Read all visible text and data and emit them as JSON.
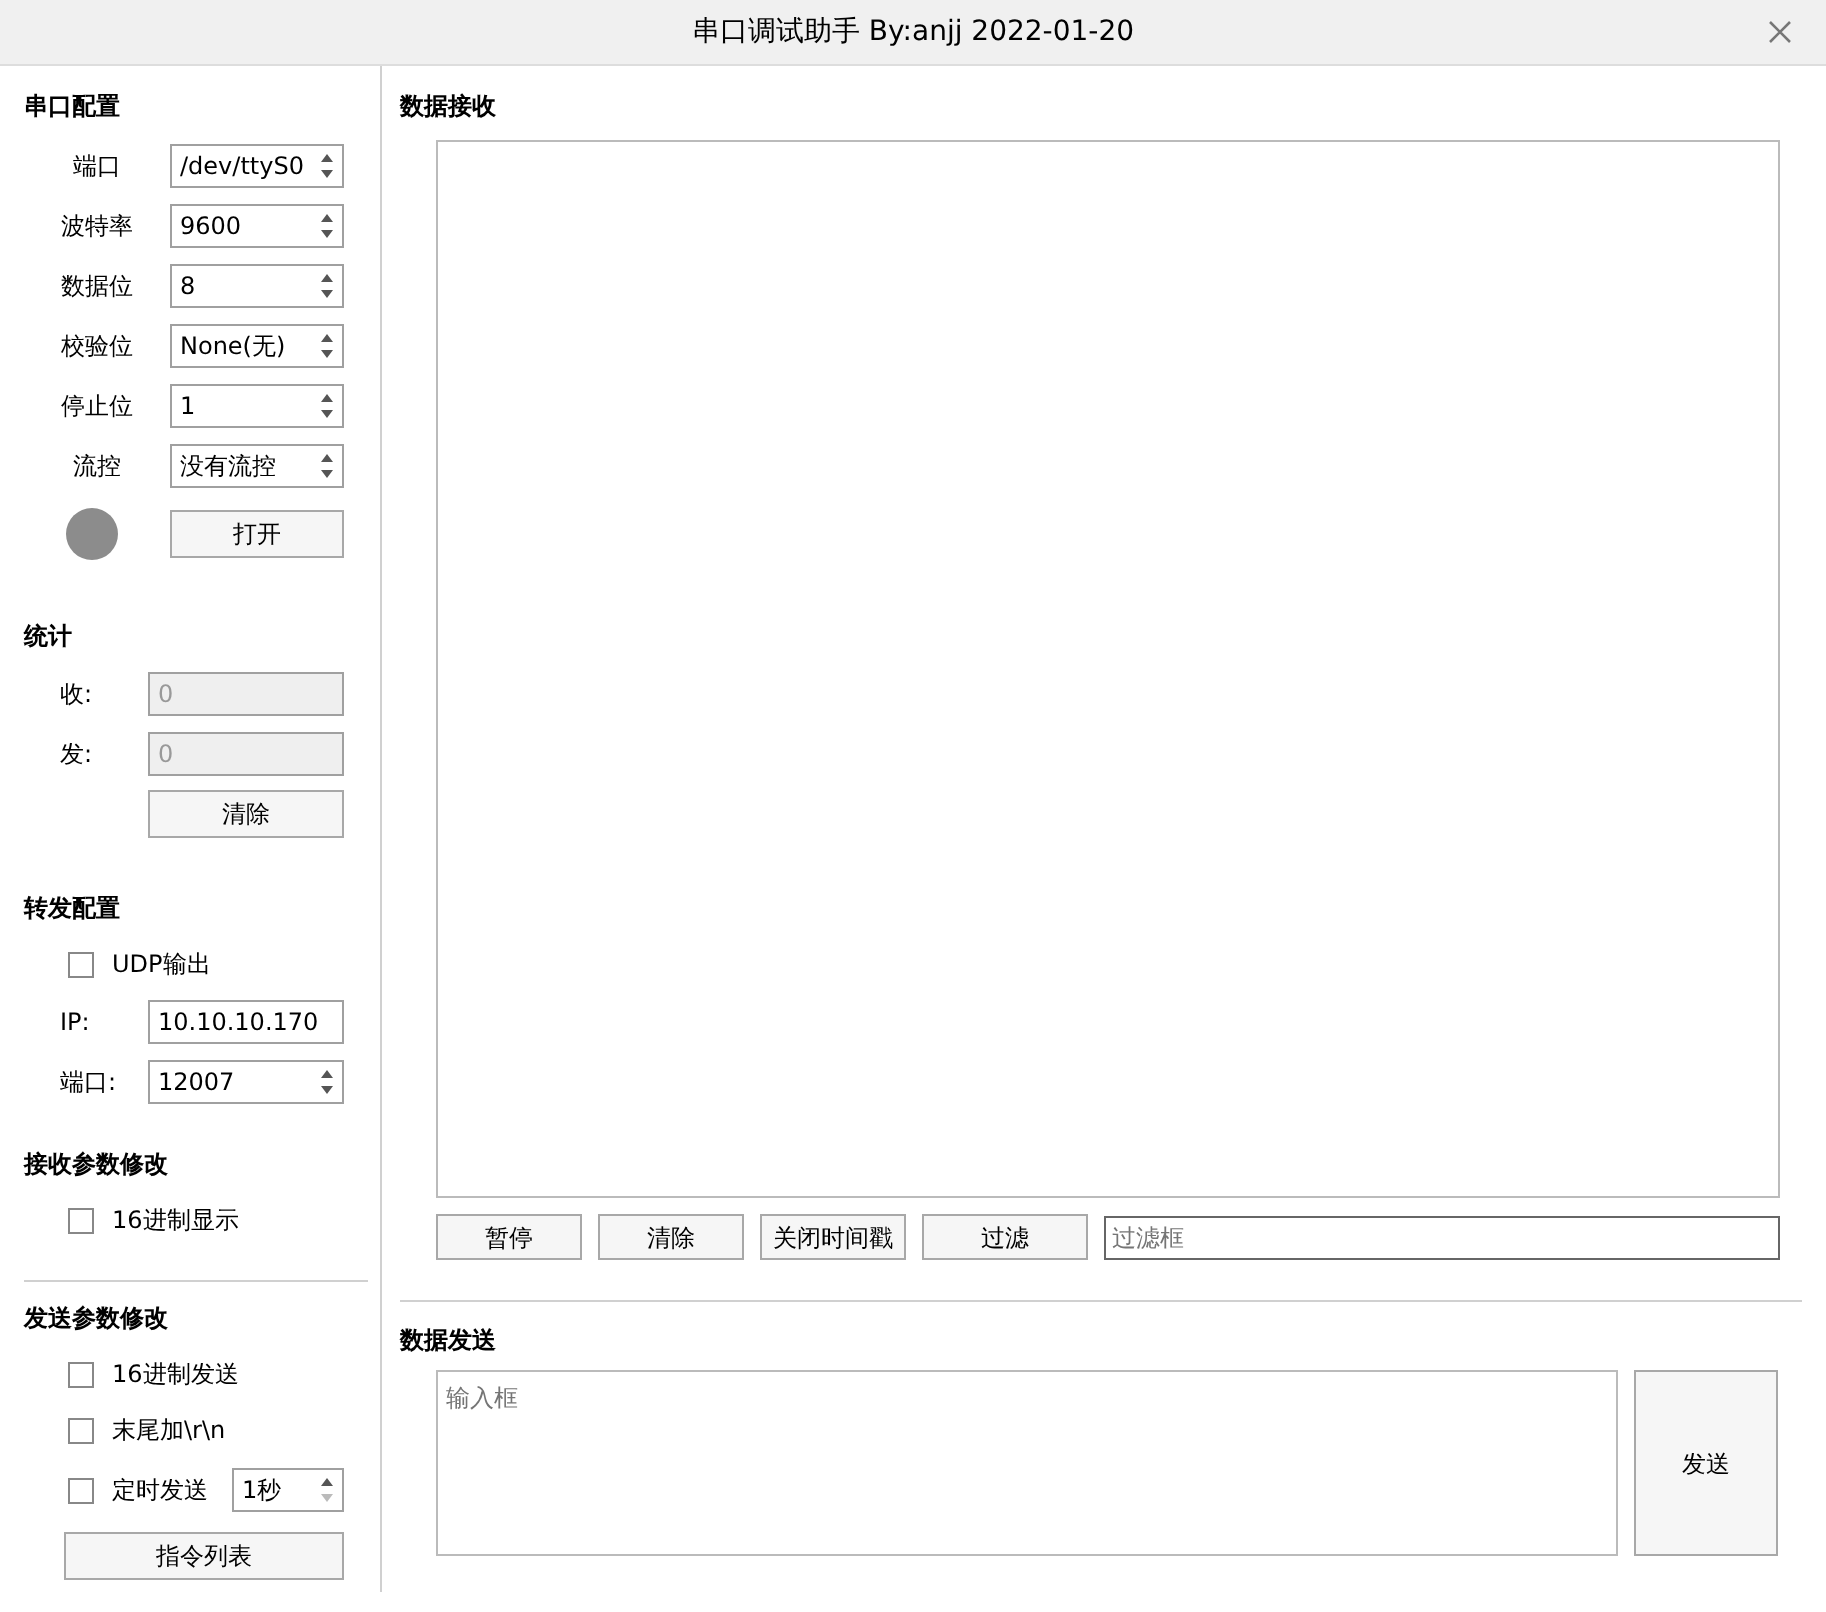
{
  "window": {
    "title": "串口调试助手 By:anjj 2022-01-20"
  },
  "serial_config": {
    "title": "串口配置",
    "fields": [
      {
        "label": "端口",
        "value": "/dev/ttyS0"
      },
      {
        "label": "波特率",
        "value": "9600"
      },
      {
        "label": "数据位",
        "value": "8"
      },
      {
        "label": "校验位",
        "value": "None(无)"
      },
      {
        "label": "停止位",
        "value": "1"
      },
      {
        "label": "流控",
        "value": "没有流控"
      }
    ],
    "status_light": {
      "on": false
    },
    "open_button": "打开"
  },
  "stats": {
    "title": "统计",
    "fields": [
      {
        "label": "收:",
        "value": "0",
        "disabled": true
      },
      {
        "label": "发:",
        "value": "0",
        "disabled": true
      }
    ],
    "clear_button": "清除"
  },
  "forward": {
    "title": "转发配置",
    "udp_output": {
      "label": "UDP输出",
      "checked": false
    },
    "ip": {
      "label": "IP:",
      "value": "10.10.10.170"
    },
    "port": {
      "label": "端口:",
      "value": "12007"
    }
  },
  "receive_params": {
    "title": "接收参数修改",
    "options": [
      {
        "label": "16进制显示",
        "checked": false
      }
    ]
  },
  "send_params": {
    "title": "发送参数修改",
    "options": [
      {
        "kind": "check",
        "label": "16进制发送",
        "checked": false
      },
      {
        "kind": "check",
        "label": "末尾加\\r\\n",
        "checked": false
      },
      {
        "kind": "timer",
        "label": "定时发送",
        "checked": false,
        "interval": "1秒"
      }
    ],
    "command_list_button": "指令列表"
  },
  "receive": {
    "title": "数据接收",
    "buttons": [
      "暂停",
      "清除",
      "关闭时间戳",
      "过滤"
    ],
    "filter": {
      "placeholder": "过滤框"
    }
  },
  "send": {
    "title": "数据发送",
    "input": {
      "placeholder": "输入框"
    },
    "send_button": "发送"
  }
}
